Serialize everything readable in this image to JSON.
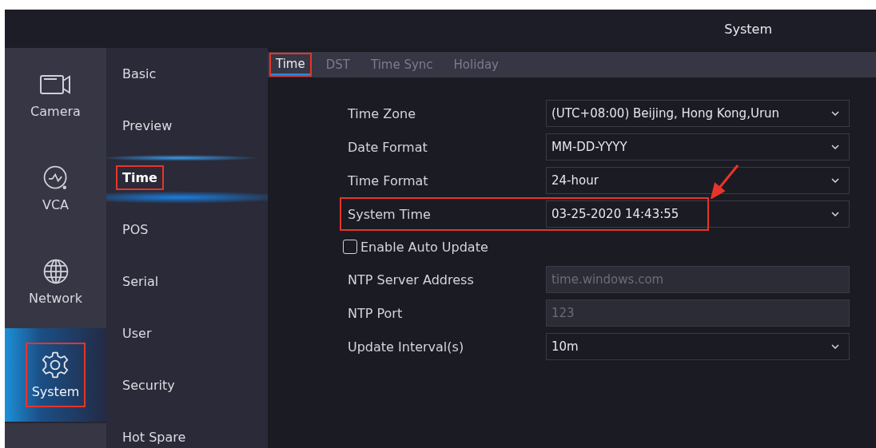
{
  "header": {
    "title": "System"
  },
  "rail": [
    {
      "label": "Camera",
      "kind": "camera",
      "selected": false,
      "highlighted": false
    },
    {
      "label": "VCA",
      "kind": "vca",
      "selected": false,
      "highlighted": false
    },
    {
      "label": "Network",
      "kind": "network",
      "selected": false,
      "highlighted": false
    },
    {
      "label": "System",
      "kind": "system",
      "selected": true,
      "highlighted": true
    }
  ],
  "submenu": [
    {
      "label": "Basic",
      "selected": false,
      "highlighted": false
    },
    {
      "label": "Preview",
      "selected": false,
      "highlighted": false
    },
    {
      "label": "Time",
      "selected": true,
      "highlighted": true
    },
    {
      "label": "POS",
      "selected": false,
      "highlighted": false
    },
    {
      "label": "Serial",
      "selected": false,
      "highlighted": false
    },
    {
      "label": "User",
      "selected": false,
      "highlighted": false
    },
    {
      "label": "Security",
      "selected": false,
      "highlighted": false
    },
    {
      "label": "Hot Spare",
      "selected": false,
      "highlighted": false
    }
  ],
  "tabs": [
    {
      "label": "Time",
      "selected": true,
      "highlighted": true
    },
    {
      "label": "DST",
      "selected": false,
      "highlighted": false
    },
    {
      "label": "Time Sync",
      "selected": false,
      "highlighted": false
    },
    {
      "label": "Holiday",
      "selected": false,
      "highlighted": false
    }
  ],
  "fields": [
    {
      "kind": "select",
      "label": "Time Zone",
      "value": "(UTC+08:00) Beijing, Hong Kong,Urun",
      "disabled": false,
      "highlighted": false
    },
    {
      "kind": "select",
      "label": "Date Format",
      "value": "MM-DD-YYYY",
      "disabled": false,
      "highlighted": false
    },
    {
      "kind": "select",
      "label": "Time Format",
      "value": "24-hour",
      "disabled": false,
      "highlighted": false
    },
    {
      "kind": "select",
      "label": "System Time",
      "value": "03-25-2020 14:43:55",
      "disabled": false,
      "highlighted": true
    },
    {
      "kind": "checkbox",
      "label": "Enable Auto Update",
      "checked": false
    },
    {
      "kind": "text",
      "label": "NTP Server Address",
      "value": "time.windows.com",
      "disabled": true,
      "highlighted": false
    },
    {
      "kind": "text",
      "label": "NTP Port",
      "value": "123",
      "disabled": true,
      "highlighted": false
    },
    {
      "kind": "select",
      "label": "Update Interval(s)",
      "value": "10m",
      "disabled": false,
      "highlighted": false
    }
  ]
}
